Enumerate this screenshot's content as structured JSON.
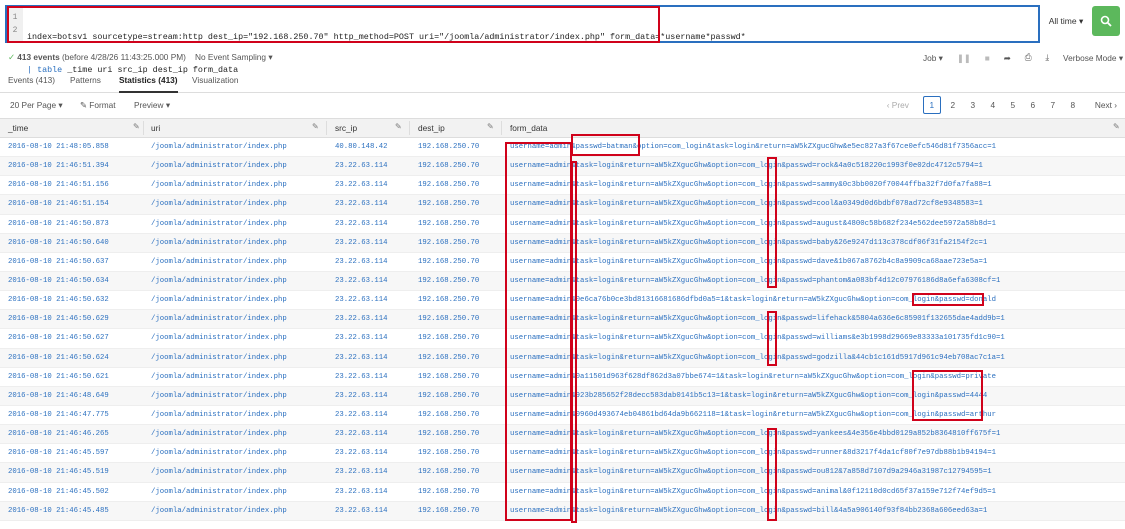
{
  "search": {
    "line_numbers": [
      "1",
      "2"
    ],
    "query_line1": "index=botsv1 sourcetype=stream:http dest_ip=\"192.168.250.70\" http_method=POST uri=\"/joomla/administrator/index.php\" form_data=*username*passwd*",
    "query_line2_pipe": "|",
    "query_line2_cmd": "table",
    "query_line2_rest": " _time uri src_ip dest_ip form_data",
    "time_range": "All time",
    "time_range_caret": "▾",
    "search_icon": "search-icon"
  },
  "status": {
    "check": "✓",
    "events_count": "413 events",
    "events_suffix": "(before 4/28/26 11:43:25.000 PM)",
    "sampling": "No Event Sampling ▾",
    "job": "Job ▾",
    "mode": "Verbose Mode ▾"
  },
  "tabs": [
    "Events (413)",
    "Patterns",
    "Statistics (413)",
    "Visualization"
  ],
  "active_tab": "Statistics (413)",
  "toolbar": {
    "per_page": "20 Per Page ▾",
    "format": "✎ Format",
    "preview": "Preview ▾"
  },
  "pager": {
    "prev": "‹ Prev",
    "pages": [
      "1",
      "2",
      "3",
      "4",
      "5",
      "6",
      "7",
      "8"
    ],
    "active_page": "1",
    "next": "Next ›"
  },
  "table": {
    "columns": [
      "_time",
      "uri",
      "src_ip",
      "dest_ip",
      "form_data"
    ],
    "rows": [
      [
        "2016-08-10 21:48:05.858",
        "/joomla/administrator/index.php",
        "40.80.148.42",
        "192.168.250.70",
        "username=admin&passwd=batman&option=com_login&task=login&return=aW5kZXgucGhw&e5ec827a3f67ce0efc546d81f7356acc=1"
      ],
      [
        "2016-08-10 21:46:51.394",
        "/joomla/administrator/index.php",
        "23.22.63.114",
        "192.168.250.70",
        "username=admin&task=login&return=aW5kZXgucGhw&option=com_login&passwd=rock&4a0c518220c1993f0e02dc4712c5794=1"
      ],
      [
        "2016-08-10 21:46:51.156",
        "/joomla/administrator/index.php",
        "23.22.63.114",
        "192.168.250.70",
        "username=admin&task=login&return=aW5kZXgucGhw&option=com_login&passwd=sammy&0c3bb0020f70044ffba32f7d0fa7fa88=1"
      ],
      [
        "2016-08-10 21:46:51.154",
        "/joomla/administrator/index.php",
        "23.22.63.114",
        "192.168.250.70",
        "username=admin&task=login&return=aW5kZXgucGhw&option=com_login&passwd=cool&a0349d0d6bdbf078ad72cf8e9348583=1"
      ],
      [
        "2016-08-10 21:46:50.873",
        "/joomla/administrator/index.php",
        "23.22.63.114",
        "192.168.250.70",
        "username=admin&task=login&return=aW5kZXgucGhw&option=com_login&passwd=august&4800c58b682f234e562dee5972a58b8d=1"
      ],
      [
        "2016-08-10 21:46:50.640",
        "/joomla/administrator/index.php",
        "23.22.63.114",
        "192.168.250.70",
        "username=admin&task=login&return=aW5kZXgucGhw&option=com_login&passwd=baby&26e9247d113c378cdf06f31fa2154f2c=1"
      ],
      [
        "2016-08-10 21:46:50.637",
        "/joomla/administrator/index.php",
        "23.22.63.114",
        "192.168.250.70",
        "username=admin&task=login&return=aW5kZXgucGhw&option=com_login&passwd=dave&1b067a8762b4c8a9909ca68aae723e5a=1"
      ],
      [
        "2016-08-10 21:46:50.634",
        "/joomla/administrator/index.php",
        "23.22.63.114",
        "192.168.250.70",
        "username=admin&task=login&return=aW5kZXgucGhw&option=com_login&passwd=phantom&a083bf4d12c07976186d8a6efa6308cf=1"
      ],
      [
        "2016-08-10 21:46:50.632",
        "/joomla/administrator/index.php",
        "23.22.63.114",
        "192.168.250.70",
        "username=admin&0e6ca76b0ce3bd81316681686dfbd0a5=1&task=login&return=aW5kZXgucGhw&option=com_login&passwd=donald"
      ],
      [
        "2016-08-10 21:46:50.629",
        "/joomla/administrator/index.php",
        "23.22.63.114",
        "192.168.250.70",
        "username=admin&task=login&return=aW5kZXgucGhw&option=com_login&passwd=lifehack&5804a636e6c85901f132655dae4add9b=1"
      ],
      [
        "2016-08-10 21:46:50.627",
        "/joomla/administrator/index.php",
        "23.22.63.114",
        "192.168.250.70",
        "username=admin&task=login&return=aW5kZXgucGhw&option=com_login&passwd=williams&e3b1998d29669e83333a101735fd1c90=1"
      ],
      [
        "2016-08-10 21:46:50.624",
        "/joomla/administrator/index.php",
        "23.22.63.114",
        "192.168.250.70",
        "username=admin&task=login&return=aW5kZXgucGhw&option=com_login&passwd=godzilla&44cb1c161d5917d961c94eb708ac7c1a=1"
      ],
      [
        "2016-08-10 21:46:50.621",
        "/joomla/administrator/index.php",
        "23.22.63.114",
        "192.168.250.70",
        "username=admin&0a11501d963f628df862d3a07bbe674=1&task=login&return=aW5kZXgucGhw&option=com_login&passwd=private"
      ],
      [
        "2016-08-10 21:46:48.649",
        "/joomla/administrator/index.php",
        "23.22.63.114",
        "192.168.250.70",
        "username=admin&923b285652f28decc583dab0141b5c13=1&task=login&return=aW5kZXgucGhw&option=com_login&passwd=4444"
      ],
      [
        "2016-08-10 21:46:47.775",
        "/joomla/administrator/index.php",
        "23.22.63.114",
        "192.168.250.70",
        "username=admin&0960d493674eb04861bd64da9b662118=1&task=login&return=aW5kZXgucGhw&option=com_login&passwd=arthur"
      ],
      [
        "2016-08-10 21:46:46.265",
        "/joomla/administrator/index.php",
        "23.22.63.114",
        "192.168.250.70",
        "username=admin&task=login&return=aW5kZXgucGhw&option=com_login&passwd=yankees&4e356e4bbd0129a852b8364810ff675f=1"
      ],
      [
        "2016-08-10 21:46:45.597",
        "/joomla/administrator/index.php",
        "23.22.63.114",
        "192.168.250.70",
        "username=admin&task=login&return=aW5kZXgucGhw&option=com_login&passwd=runner&8d3217f4da1cf80f7e97db88b1b94194=1"
      ],
      [
        "2016-08-10 21:46:45.519",
        "/joomla/administrator/index.php",
        "23.22.63.114",
        "192.168.250.70",
        "username=admin&task=login&return=aW5kZXgucGhw&option=com_login&passwd=ou812&7a858d7107d9a2946a31987c12794595=1"
      ],
      [
        "2016-08-10 21:46:45.502",
        "/joomla/administrator/index.php",
        "23.22.63.114",
        "192.168.250.70",
        "username=admin&task=login&return=aW5kZXgucGhw&option=com_login&passwd=animal&0f12110d0cd65f37a159e712f74ef9d5=1"
      ],
      [
        "2016-08-10 21:46:45.485",
        "/joomla/administrator/index.php",
        "23.22.63.114",
        "192.168.250.70",
        "username=admin&task=login&return=aW5kZXgucGhw&option=com_login&passwd=bill&4a5a906140f93f84bb2368a606eed63a=1"
      ]
    ]
  },
  "colors": {
    "accent_blue": "#2a6fbf",
    "annotation_red": "#d0021b",
    "search_green": "#5cb85c"
  }
}
